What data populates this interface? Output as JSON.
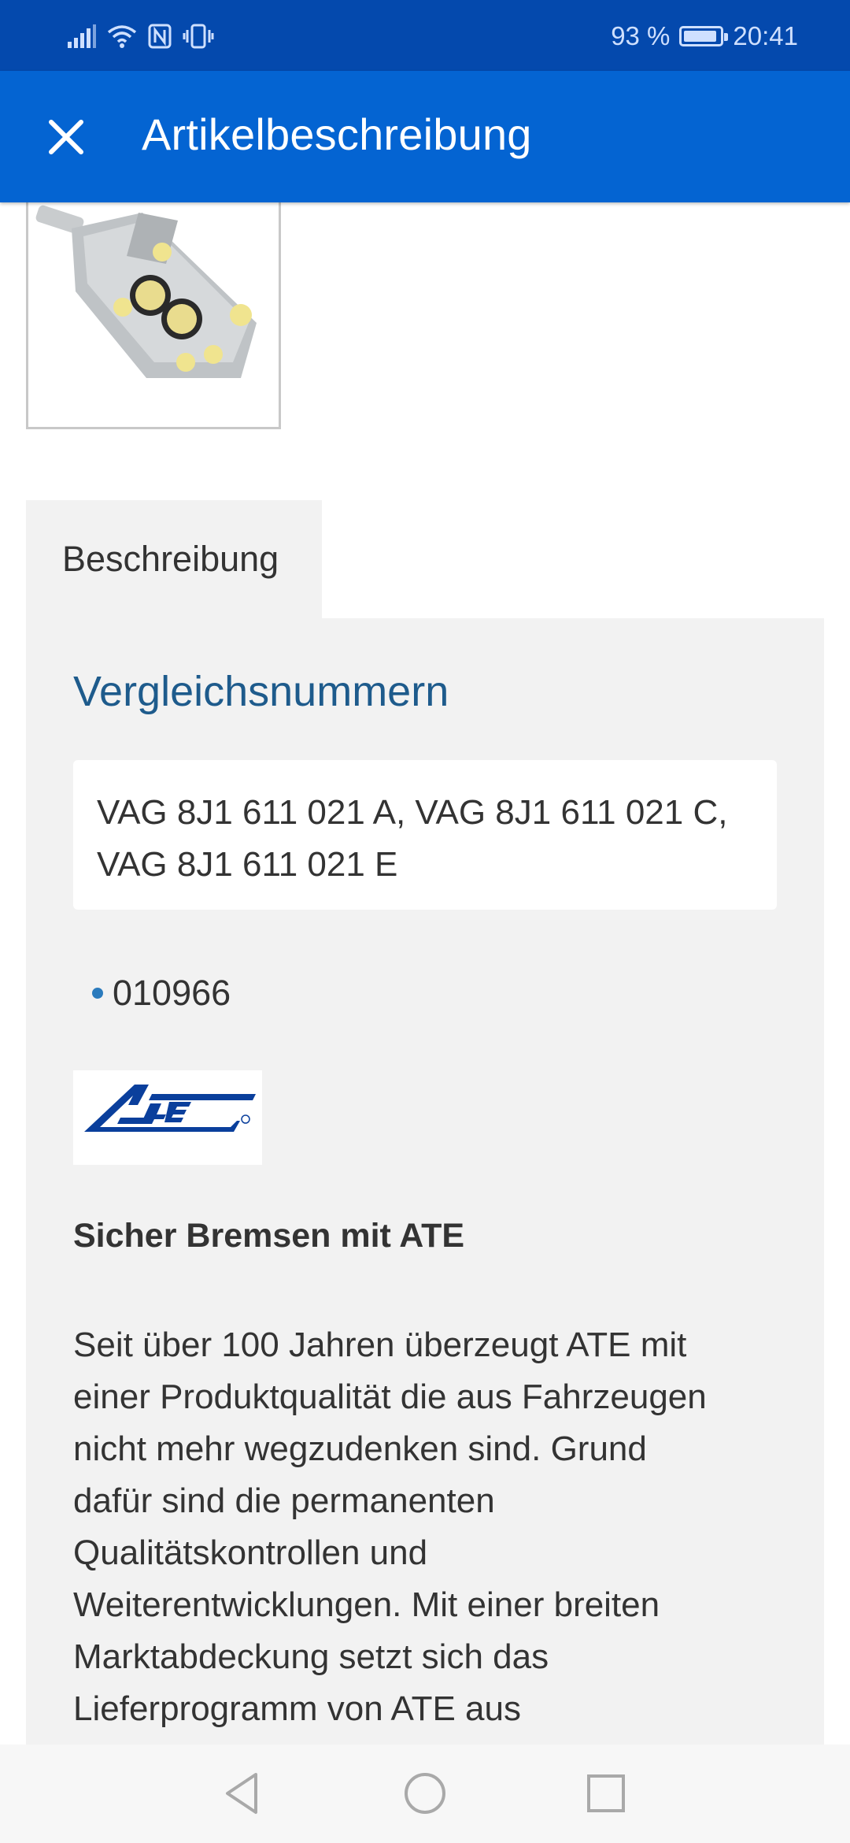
{
  "status_bar": {
    "battery_percent": "93 %",
    "battery_level": 0.93,
    "time": "20:41"
  },
  "app_bar": {
    "title": "Artikelbeschreibung",
    "close_icon": "close-icon"
  },
  "tabs": [
    {
      "label": "Beschreibung",
      "active": true
    }
  ],
  "section": {
    "title": "Vergleichsnummern",
    "numbers_line1": "VAG 8J1 611 021 A, VAG 8J1 611 021 C,",
    "numbers_line2": "VAG 8J1 611 021 E"
  },
  "list": [
    "010966"
  ],
  "brand": {
    "logo_text": "Ate",
    "color": "#0a3f9c"
  },
  "sub_heading": "Sicher Bremsen mit ATE",
  "body_lines": [
    "Seit über 100 Jahren überzeugt ATE mit",
    "einer Produktqualität die aus Fahrzeugen",
    "nicht mehr wegzudenken sind. Grund",
    "dafür sind die permanenten",
    "Qualitätskontrollen und",
    "Weiterentwicklungen. Mit einer breiten",
    "Marktabdeckung setzt sich das",
    "Lieferprogramm von ATE aus"
  ],
  "colors": {
    "status_bar": "#0449ad",
    "app_bar": "#0464d2",
    "panel": "#f2f2f2",
    "section_title": "#1e5b8c"
  }
}
